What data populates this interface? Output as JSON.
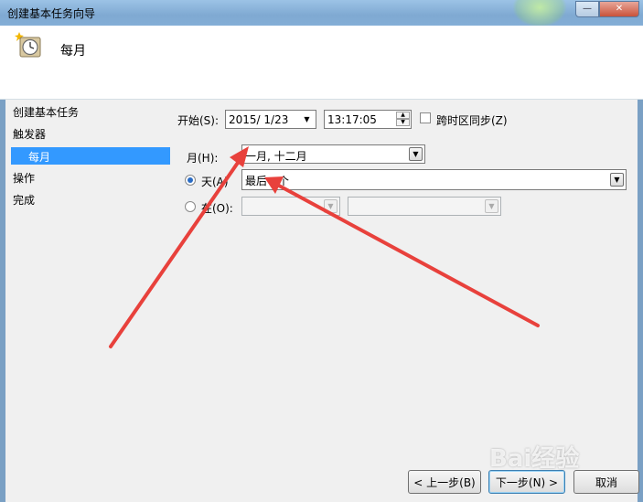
{
  "window": {
    "title": "创建基本任务向导",
    "minimize_glyph": "—",
    "close_glyph": "✕"
  },
  "header": {
    "title": "每月",
    "icon": "clock-icon"
  },
  "nav": {
    "items": [
      {
        "label": "创建基本任务"
      },
      {
        "label": "触发器"
      },
      {
        "label": "每月",
        "selected": true
      },
      {
        "label": "操作"
      },
      {
        "label": "完成"
      }
    ]
  },
  "form": {
    "start_label": "开始(S):",
    "start_date": "2015/  1/23",
    "start_time": "13:17:05",
    "timezone_sync_label": "跨时区同步(Z)",
    "timezone_sync_checked": false,
    "months_label": "月(H):",
    "months_value": "一月, 十二月",
    "days_radio_label": "天(A)",
    "days_value": "最后一个",
    "on_radio_label": "在(O):",
    "selected_radio": "days"
  },
  "buttons": {
    "back": "< 上一步(B)",
    "next": "下一步(N) >",
    "cancel": "取消"
  },
  "watermark": {
    "text": "Bai经验"
  },
  "colors": {
    "selection": "#3399ff",
    "annotation_arrow": "#e8413c",
    "content_bg": "#f0f0f0"
  }
}
